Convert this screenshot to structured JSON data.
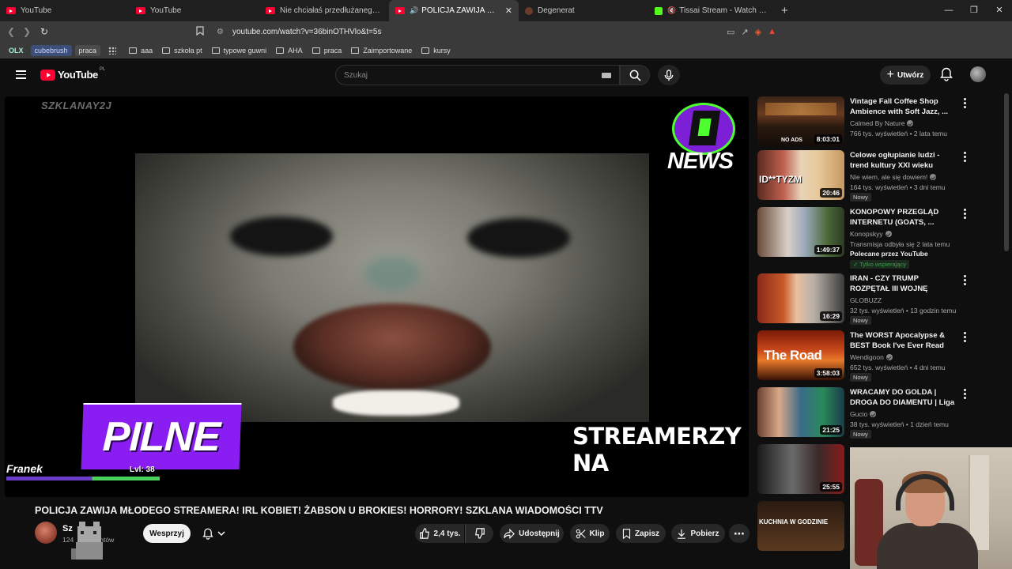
{
  "browser": {
    "tabs": [
      {
        "label": "YouTube",
        "icon": "youtube-icon"
      },
      {
        "label": "YouTube",
        "icon": "youtube-icon"
      },
      {
        "label": "Nie chciałaś przedłużanego, ale żyć z",
        "icon": "youtube-icon"
      },
      {
        "label": "POLICJA ZAWIJA MŁODEGO S",
        "icon": "youtube-icon",
        "active": true
      },
      {
        "label": "Degenerat",
        "icon": "generic-icon"
      },
      {
        "label": "Tissai Stream - Watch Live on Kic",
        "icon": "kick-icon"
      }
    ],
    "url": "youtube.com/watch?v=36binOTHVlo&t=5s",
    "bookmarks": {
      "chips": [
        "OLX",
        "cubebrush",
        "praca"
      ],
      "folders": [
        "aaa",
        "szkoła pt",
        "typowe guwni",
        "AHA",
        "praca",
        "Zaimportowane",
        "kursy"
      ]
    }
  },
  "youtube": {
    "logo_text": "YouTube",
    "logo_region": "PL",
    "search_placeholder": "Szukaj",
    "create_label": "Utwórz"
  },
  "player": {
    "watermark": "SZKLANAY2J",
    "news_logo_text": "NEWS",
    "pilne_text": "PILNE",
    "ticker_text": "STREAMERZY NA",
    "game_name": "Franek",
    "game_level": "Lvl: 38",
    "game_bar_progress": 0.56
  },
  "video": {
    "title": "POLICJA ZAWIJA MŁODEGO STREAMERA! IRL KOBIET! ŻABSON U BROKIES! HORRORY! SZKLANA WIADOMOŚCI TTV",
    "channel_name": "Sz",
    "subscribers": "124",
    "subscribers_suffix": "entów",
    "support_label": "Wesprzyj",
    "likes": "2,4 tys.",
    "share_label": "Udostępnij",
    "clip_label": "Klip",
    "save_label": "Zapisz",
    "download_label": "Pobierz"
  },
  "recommendations": [
    {
      "title": "Vintage Fall Coffee Shop Ambience with Soft Jazz, ...",
      "channel": "Calmed By Nature",
      "verified": true,
      "stats": "766 tys. wyświetleń • 2 lata temu",
      "duration": "8:03:01",
      "badge": ""
    },
    {
      "title": "Celowe ogłupianie ludzi - trend kultury XXI wieku",
      "channel": "Nie wiem, ale się dowiem!",
      "verified": true,
      "stats": "164 tys. wyświetleń • 3 dni temu",
      "duration": "20:46",
      "badge": "Nowy"
    },
    {
      "title": "KONOPOWY PRZEGLĄD INTERNETU (GOATS, ...",
      "channel": "Konopskyy",
      "verified": true,
      "stats": "Transmisja odbyła się 2 lata temu",
      "duration": "1:49:37",
      "badge": "",
      "promo": "Polecane przez YouTube",
      "members": "Tylko wspierający"
    },
    {
      "title": "IRAN - CZY TRUMP ROZPĘTAŁ III WOJNĘ ŚWIATOWĄ?",
      "channel": "GLOBUZZ",
      "verified": false,
      "stats": "32 tys. wyświetleń • 13 godzin temu",
      "duration": "16:29",
      "badge": "Nowy"
    },
    {
      "title": "The WORST Apocalypse & BEST Book I've Ever Read",
      "channel": "Wendigoon",
      "verified": true,
      "stats": "652 tys. wyświetleń • 4 dni temu",
      "duration": "3:58:03",
      "badge": "Nowy"
    },
    {
      "title": "WRACAMY DO GOLDA | DROGA DO DIAMENTU | Liga Legend",
      "channel": "Gucio",
      "verified": true,
      "stats": "38 tys. wyświetleń • 1 dzień temu",
      "duration": "21:25",
      "badge": "Nowy"
    },
    {
      "title": "",
      "channel": "",
      "stats": "",
      "duration": "25:55",
      "badge": ""
    }
  ],
  "thumb_texts": {
    "rec0_overlay": "NO ADS",
    "rec1_overlay": "ID**TYZM",
    "rec4_overlay": "The Road",
    "rec6_overlay": "KUCHNIA W GODZINIE"
  },
  "colors": {
    "yt_red": "#ff0033",
    "pilne_purple": "#8a1ef2",
    "news_green": "#4dff2f"
  }
}
